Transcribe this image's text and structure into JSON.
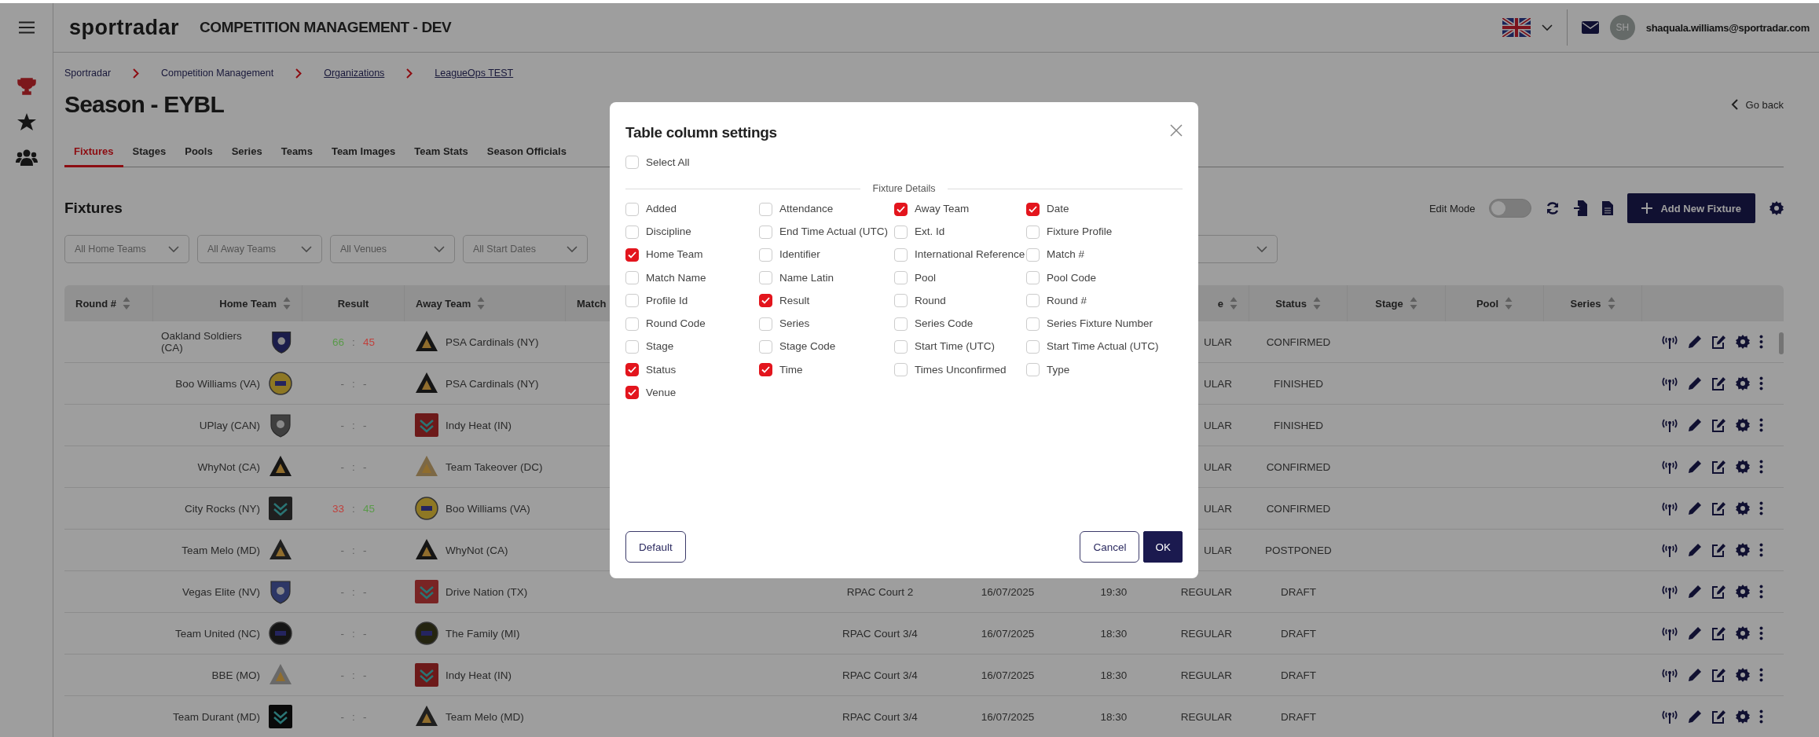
{
  "app": {
    "logo": "sportradar",
    "title": "COMPETITION MANAGEMENT - DEV"
  },
  "user": {
    "initials": "SH",
    "email": "shaquala.williams@sportradar.com"
  },
  "breadcrumbs": [
    {
      "label": "Sportradar",
      "link": false
    },
    {
      "label": "Competition Management",
      "link": false
    },
    {
      "label": "Organizations",
      "link": true
    },
    {
      "label": "LeagueOps TEST",
      "link": true
    }
  ],
  "page": {
    "title": "Season - EYBL",
    "back": "Go back"
  },
  "tabs": [
    {
      "label": "Fixtures",
      "selected": true
    },
    {
      "label": "Stages",
      "selected": false
    },
    {
      "label": "Pools",
      "selected": false
    },
    {
      "label": "Series",
      "selected": false
    },
    {
      "label": "Teams",
      "selected": false
    },
    {
      "label": "Team Images",
      "selected": false
    },
    {
      "label": "Team Stats",
      "selected": false
    },
    {
      "label": "Season Officials",
      "selected": false
    }
  ],
  "section": {
    "title": "Fixtures",
    "edit_mode_label": "Edit Mode",
    "edit_mode_on": false,
    "add_button": "Add New Fixture"
  },
  "filters": [
    {
      "placeholder": "All Home Teams"
    },
    {
      "placeholder": "All Away Teams"
    },
    {
      "placeholder": "All Venues"
    },
    {
      "placeholder": "All Start Dates"
    }
  ],
  "table": {
    "columns": [
      {
        "label": "Round #",
        "sortable": true
      },
      {
        "label": "Home Team",
        "sortable": true
      },
      {
        "label": "Result",
        "sortable": false
      },
      {
        "label": "Away Team",
        "sortable": true
      },
      {
        "label": "Match",
        "sortable": false
      },
      {
        "label": "e",
        "sortable": true
      },
      {
        "label": "Status",
        "sortable": true
      },
      {
        "label": "Stage",
        "sortable": true
      },
      {
        "label": "Pool",
        "sortable": true
      },
      {
        "label": "Series",
        "sortable": true
      }
    ],
    "rows": [
      {
        "home": "Oakland Soldiers (CA)",
        "result": {
          "home": {
            "text": "66",
            "color": "#5a9a4a"
          },
          "sep": ":",
          "away": {
            "text": "45",
            "color": "#c0403c"
          }
        },
        "away": "PSA Cardinals (NY)",
        "type": "ULAR",
        "status": "CONFIRMED"
      },
      {
        "home": "Boo Williams (VA)",
        "result": {
          "home": "-",
          "sep": ":",
          "away": "-"
        },
        "away": "PSA Cardinals (NY)",
        "type": "ULAR",
        "status": "FINISHED"
      },
      {
        "home": "UPlay (CAN)",
        "result": {
          "home": "-",
          "sep": ":",
          "away": "-"
        },
        "away": "Indy Heat (IN)",
        "type": "ULAR",
        "status": "FINISHED"
      },
      {
        "home": "WhyNot (CA)",
        "result": {
          "home": "-",
          "sep": ":",
          "away": "-"
        },
        "away": "Team Takeover (DC)",
        "type": "ULAR",
        "status": "CONFIRMED"
      },
      {
        "home": "City Rocks (NY)",
        "result": {
          "home": {
            "text": "33",
            "color": "#c0403c"
          },
          "sep": ":",
          "away": {
            "text": "45",
            "color": "#5a9a4a"
          }
        },
        "away": "Boo Williams (VA)",
        "type": "ULAR",
        "status": "CONFIRMED"
      },
      {
        "home": "Team Melo (MD)",
        "result": {
          "home": "-",
          "sep": ":",
          "away": "-"
        },
        "away": "WhyNot (CA)",
        "type": "ULAR",
        "status": "POSTPONED"
      },
      {
        "home": "Vegas Elite (NV)",
        "result": {
          "home": "-",
          "sep": ":",
          "away": "-"
        },
        "away": "Drive Nation (TX)",
        "venue": "RPAC Court 2",
        "date": "16/07/2025",
        "time": "19:30",
        "type": "REGULAR",
        "status": "DRAFT"
      },
      {
        "home": "Team United (NC)",
        "result": {
          "home": "-",
          "sep": ":",
          "away": "-"
        },
        "away": "The Family (MI)",
        "venue": "RPAC Court 3/4",
        "date": "16/07/2025",
        "time": "18:30",
        "type": "REGULAR",
        "status": "DRAFT"
      },
      {
        "home": "BBE (MO)",
        "result": {
          "home": "-",
          "sep": ":",
          "away": "-"
        },
        "away": "Indy Heat (IN)",
        "venue": "RPAC Court 3/4",
        "date": "16/07/2025",
        "time": "18:30",
        "type": "REGULAR",
        "status": "DRAFT"
      },
      {
        "home": "Team Durant (MD)",
        "result": {
          "home": "-",
          "sep": ":",
          "away": "-"
        },
        "away": "Team Melo (MD)",
        "venue": "RPAC Court 3/4",
        "date": "16/07/2025",
        "time": "18:30",
        "type": "REGULAR",
        "status": "DRAFT"
      }
    ]
  },
  "dialog": {
    "title": "Table column settings",
    "select_all": {
      "label": "Select All",
      "checked": false
    },
    "section": "Fixture Details",
    "options": [
      {
        "label": "Added",
        "checked": false
      },
      {
        "label": "Attendance",
        "checked": false
      },
      {
        "label": "Away Team",
        "checked": true
      },
      {
        "label": "Date",
        "checked": true
      },
      {
        "label": "Discipline",
        "checked": false
      },
      {
        "label": "End Time Actual (UTC)",
        "checked": false
      },
      {
        "label": "Ext. Id",
        "checked": false
      },
      {
        "label": "Fixture Profile",
        "checked": false
      },
      {
        "label": "Home Team",
        "checked": true
      },
      {
        "label": "Identifier",
        "checked": false
      },
      {
        "label": "International Reference",
        "checked": false
      },
      {
        "label": "Match #",
        "checked": false
      },
      {
        "label": "Match Name",
        "checked": false
      },
      {
        "label": "Name Latin",
        "checked": false
      },
      {
        "label": "Pool",
        "checked": false
      },
      {
        "label": "Pool Code",
        "checked": false
      },
      {
        "label": "Profile Id",
        "checked": false
      },
      {
        "label": "Result",
        "checked": true
      },
      {
        "label": "Round",
        "checked": false
      },
      {
        "label": "Round #",
        "checked": false
      },
      {
        "label": "Round Code",
        "checked": false
      },
      {
        "label": "Series",
        "checked": false
      },
      {
        "label": "Series Code",
        "checked": false
      },
      {
        "label": "Series Fixture Number",
        "checked": false
      },
      {
        "label": "Stage",
        "checked": false
      },
      {
        "label": "Stage Code",
        "checked": false
      },
      {
        "label": "Start Time (UTC)",
        "checked": false
      },
      {
        "label": "Start Time Actual (UTC)",
        "checked": false
      },
      {
        "label": "Status",
        "checked": true
      },
      {
        "label": "Time",
        "checked": true
      },
      {
        "label": "Times Unconfirmed",
        "checked": false
      },
      {
        "label": "Type",
        "checked": false
      },
      {
        "label": "Venue",
        "checked": true
      }
    ],
    "default_button": "Default",
    "cancel_button": "Cancel",
    "ok_button": "OK"
  }
}
